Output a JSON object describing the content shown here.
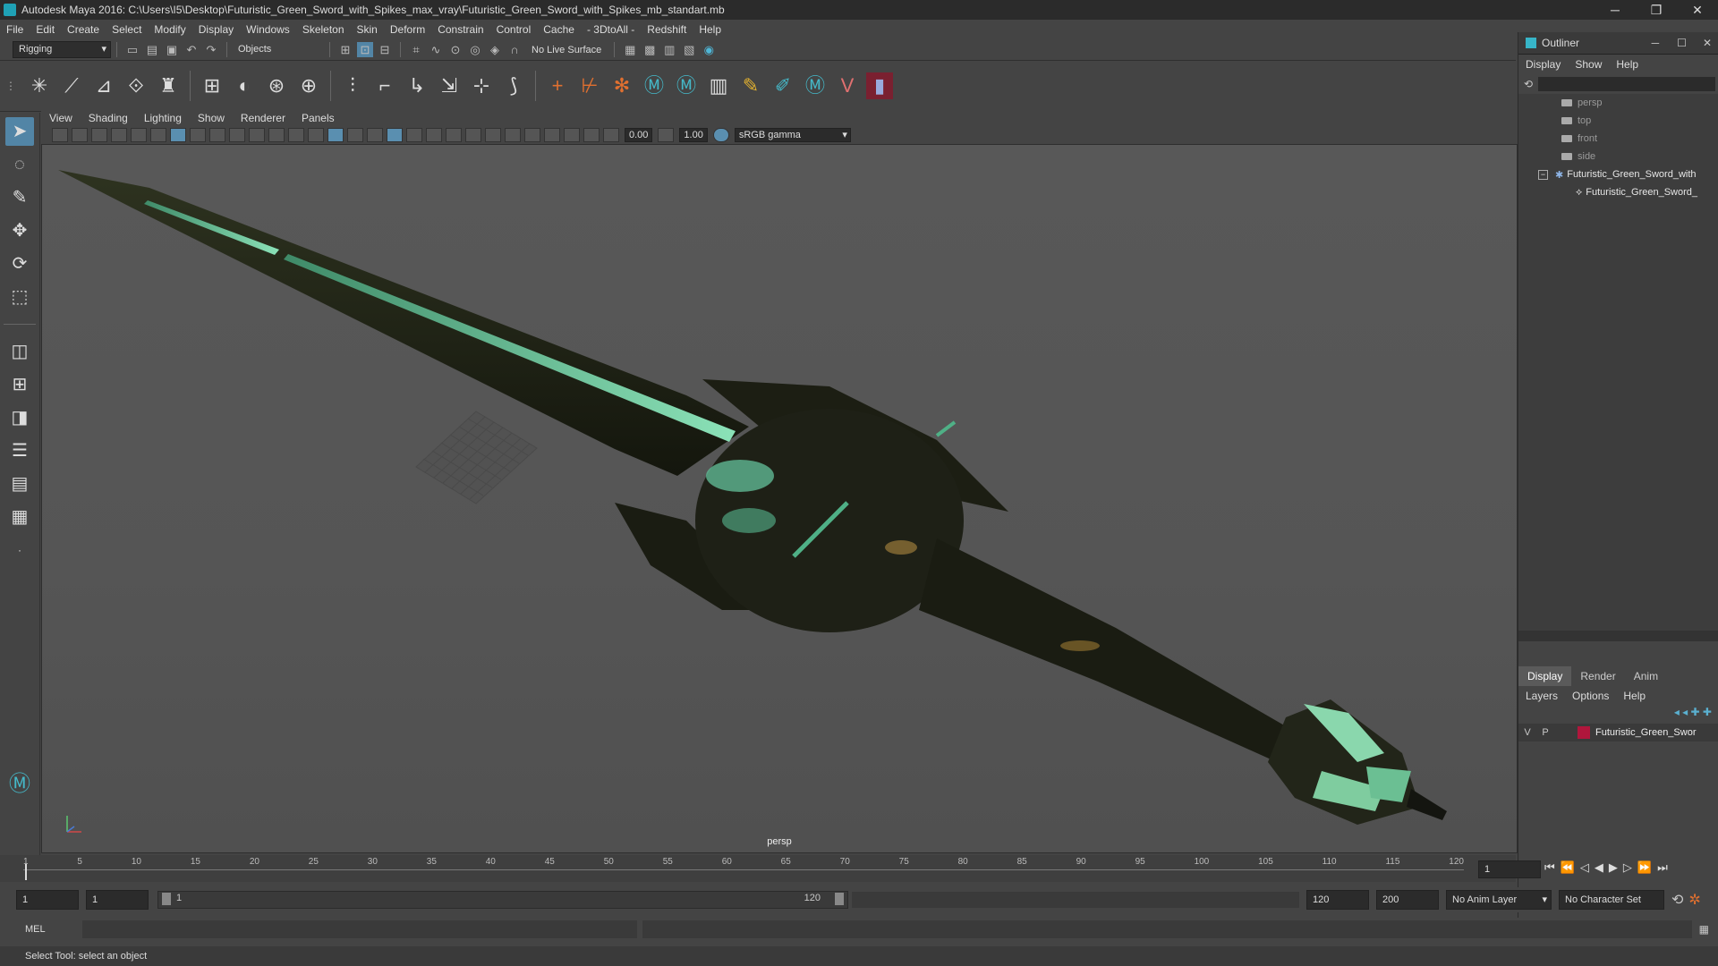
{
  "title": "Autodesk Maya 2016: C:\\Users\\I5\\Desktop\\Futuristic_Green_Sword_with_Spikes_max_vray\\Futuristic_Green_Sword_with_Spikes_mb_standart.mb",
  "window_buttons": [
    "─",
    "❐",
    "✕"
  ],
  "menu": [
    "File",
    "Edit",
    "Create",
    "Select",
    "Modify",
    "Display",
    "Windows",
    "Skeleton",
    "Skin",
    "Deform",
    "Constrain",
    "Control",
    "Cache",
    "- 3DtoAll -",
    "Redshift",
    "Help"
  ],
  "status": {
    "mode": "Rigging",
    "objects": "Objects",
    "live_surface": "No Live Surface"
  },
  "panel_menu": [
    "View",
    "Shading",
    "Lighting",
    "Show",
    "Renderer",
    "Panels"
  ],
  "panel_fields": {
    "exposure": "0.00",
    "gamma": "1.00",
    "colorspace": "sRGB gamma"
  },
  "viewport_label": "persp",
  "outliner": {
    "title": "Outliner",
    "menu": [
      "Display",
      "Show",
      "Help"
    ],
    "items": [
      "persp",
      "top",
      "front",
      "side",
      "Futuristic_Green_Sword_with",
      "Futuristic_Green_Sword_"
    ],
    "tabs": [
      "Display",
      "Render",
      "Anim"
    ],
    "layer_menu": [
      "Layers",
      "Options",
      "Help"
    ],
    "layer": {
      "v": "V",
      "p": "P",
      "name": "Futuristic_Green_Swor",
      "color": "#b0163c"
    }
  },
  "timeline": {
    "ticks": [
      "1",
      "5",
      "10",
      "15",
      "20",
      "25",
      "30",
      "35",
      "40",
      "45",
      "50",
      "55",
      "60",
      "65",
      "70",
      "75",
      "80",
      "85",
      "90",
      "95",
      "100",
      "105",
      "110",
      "115",
      "120"
    ],
    "current_frame": "1"
  },
  "range": {
    "start": "1",
    "playback_start": "1",
    "slider_start": "1",
    "slider_end": "120",
    "playback_end": "120",
    "end": "200",
    "anim_layer": "No Anim Layer",
    "character_set": "No Character Set"
  },
  "cmdline": {
    "label": "MEL"
  },
  "helpline": "Select Tool: select an object",
  "colors": {
    "accent": "#5285a6",
    "blade_glow": "#6fd3a6"
  }
}
